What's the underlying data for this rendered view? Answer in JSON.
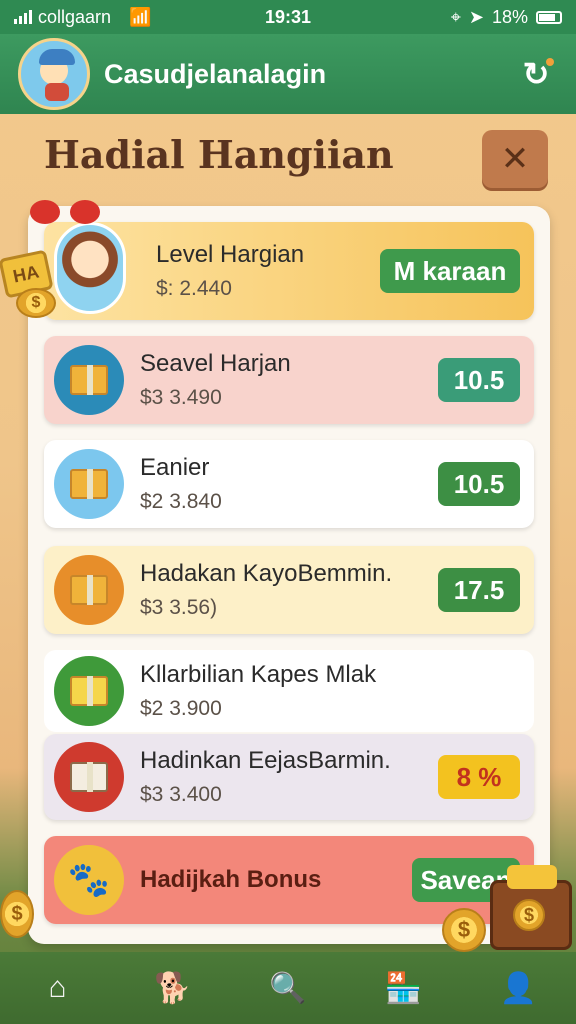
{
  "status_bar": {
    "carrier": "collgaarn",
    "time": "19:31",
    "battery": "18%"
  },
  "header": {
    "title": "Casudjelanalagin"
  },
  "panel": {
    "title": "Hadial Hangiian"
  },
  "decor": {
    "sign_text": "HA"
  },
  "featured": {
    "name": "Level Hargian",
    "price": "$: 2.440",
    "action_label": "M karaan",
    "action_color": "#3f9a4c"
  },
  "rewards": [
    {
      "name": "Seavel Harjan",
      "price": "$3 3.490",
      "action_label": "10.5",
      "action_color": "#3a9c78",
      "bg": "#f8d3cc",
      "icon": "box-icon",
      "icon_bg": "#2b8bb8"
    },
    {
      "name": "Eanier",
      "price": "$2 3.840",
      "action_label": "10.5",
      "action_color": "#3d8f44",
      "bg": "#ffffff",
      "icon": "box-coin-icon",
      "icon_bg": "#7cc7ee"
    },
    {
      "name": "Hadakan KayoBemmin.",
      "price": "$3 3.56)",
      "action_label": "17.5",
      "action_color": "#3d8f44",
      "bg": "#fdf0c8",
      "icon": "box-icon",
      "icon_bg": "#e78e2a"
    },
    {
      "name": "Kllarbilian Kapes Mlak",
      "price": "$2 3.900",
      "action_label": "",
      "action_color": "#3d8f44",
      "bg": "#ffffff",
      "icon": "gift-icon",
      "icon_bg": "#3f9a3a"
    },
    {
      "name": "Hadinkan EejasBarmin.",
      "price": "$3 3.400",
      "action_label": "8 %",
      "action_color": "#f3c21f",
      "bg": "#ece6ee",
      "icon": "crate-icon",
      "icon_bg": "#cf3a2e"
    },
    {
      "name": "Hadijkah Bonus",
      "price": "",
      "action_label": "Savean",
      "action_color": "#3f9a4c",
      "bg": "#f3877a",
      "icon": "pet-icon",
      "icon_bg": "#f1c03b"
    }
  ],
  "nav": [
    {
      "icon": "home-icon"
    },
    {
      "icon": "dog-icon"
    },
    {
      "icon": "search-icon"
    },
    {
      "icon": "store-icon"
    },
    {
      "icon": "profile-icon"
    }
  ]
}
